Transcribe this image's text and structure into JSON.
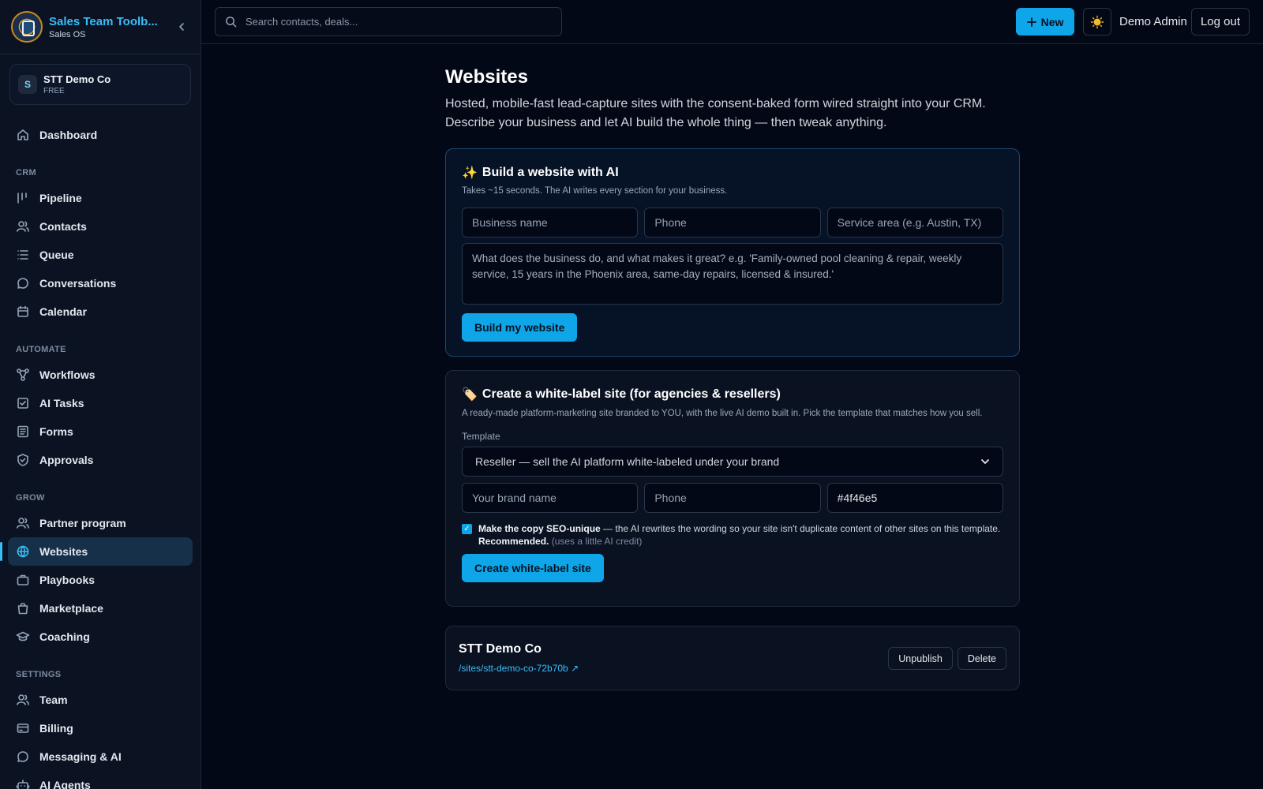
{
  "brand": {
    "title": "Sales Team Toolb...",
    "subtitle": "Sales OS"
  },
  "org": {
    "initial": "S",
    "name": "STT Demo Co",
    "plan": "FREE"
  },
  "sidebar": {
    "top": [
      {
        "label": "Dashboard",
        "icon": "home-icon"
      }
    ],
    "sections": [
      {
        "title": "CRM",
        "items": [
          {
            "label": "Pipeline",
            "icon": "kanban-icon"
          },
          {
            "label": "Contacts",
            "icon": "users-icon"
          },
          {
            "label": "Queue",
            "icon": "list-icon"
          },
          {
            "label": "Conversations",
            "icon": "chat-icon"
          },
          {
            "label": "Calendar",
            "icon": "calendar-icon"
          }
        ]
      },
      {
        "title": "AUTOMATE",
        "items": [
          {
            "label": "Workflows",
            "icon": "workflow-icon"
          },
          {
            "label": "AI Tasks",
            "icon": "checkbox-icon"
          },
          {
            "label": "Forms",
            "icon": "form-icon"
          },
          {
            "label": "Approvals",
            "icon": "shield-icon"
          }
        ]
      },
      {
        "title": "GROW",
        "items": [
          {
            "label": "Partner program",
            "icon": "users-icon"
          },
          {
            "label": "Websites",
            "icon": "globe-icon",
            "active": true
          },
          {
            "label": "Playbooks",
            "icon": "briefcase-icon"
          },
          {
            "label": "Marketplace",
            "icon": "bag-icon"
          },
          {
            "label": "Coaching",
            "icon": "graduation-icon"
          }
        ]
      },
      {
        "title": "SETTINGS",
        "items": [
          {
            "label": "Team",
            "icon": "users-icon"
          },
          {
            "label": "Billing",
            "icon": "card-icon"
          },
          {
            "label": "Messaging & AI",
            "icon": "chat-icon"
          },
          {
            "label": "AI Agents",
            "icon": "bot-icon"
          }
        ]
      }
    ]
  },
  "topbar": {
    "search_placeholder": "Search contacts, deals...",
    "new_label": "New",
    "user_name": "Demo Admin",
    "logout_label": "Log out"
  },
  "page": {
    "title": "Websites",
    "description": "Hosted, mobile-fast lead-capture sites with the consent-baked form wired straight into your CRM. Describe your business and let AI build the whole thing — then tweak anything."
  },
  "ai_builder": {
    "emoji": "✨",
    "title": "Build a website with AI",
    "subtitle": "Takes ~15 seconds. The AI writes every section for your business.",
    "business_name_placeholder": "Business name",
    "phone_placeholder": "Phone",
    "service_area_placeholder": "Service area (e.g. Austin, TX)",
    "description_placeholder": "What does the business do, and what makes it great? e.g. 'Family-owned pool cleaning & repair, weekly service, 15 years in the Phoenix area, same-day repairs, licensed & insured.'",
    "button_label": "Build my website"
  },
  "white_label": {
    "emoji": "🏷️",
    "title": "Create a white-label site (for agencies & resellers)",
    "subtitle": "A ready-made platform-marketing site branded to YOU, with the live AI demo built in. Pick the template that matches how you sell.",
    "template_label": "Template",
    "template_value": "Reseller — sell the AI platform white-labeled under your brand",
    "brand_name_placeholder": "Your brand name",
    "phone_placeholder": "Phone",
    "color_value": "#4f46e5",
    "seo_bold": "Make the copy SEO-unique",
    "seo_text": " — the AI rewrites the wording so your site isn't duplicate content of other sites on this template. ",
    "seo_bold2": "Recommended.",
    "seo_muted": " (uses a little AI credit)",
    "seo_checked": true,
    "button_label": "Create white-label site"
  },
  "site": {
    "name": "STT Demo Co",
    "link": "/sites/stt-demo-co-72b70b ↗",
    "unpublish_label": "Unpublish",
    "delete_label": "Delete"
  },
  "colors": {
    "accent": "#0ea5e9",
    "link": "#38bdf8",
    "background": "#030816",
    "sidebar": "#0b1322"
  }
}
